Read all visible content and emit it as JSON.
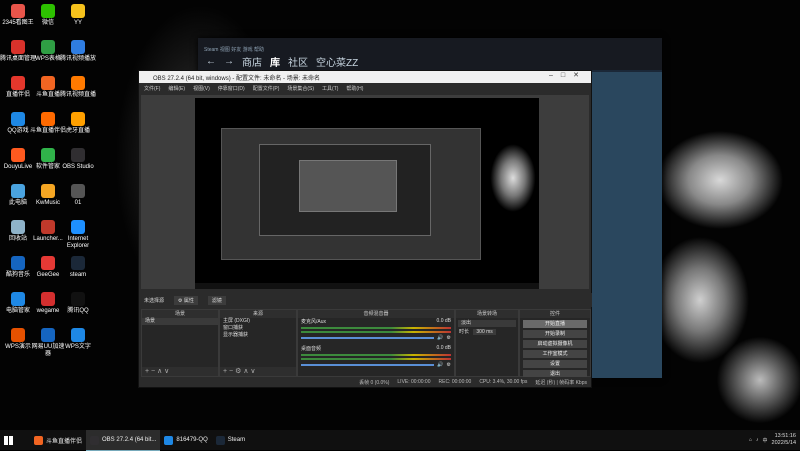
{
  "desktop": {
    "icons": [
      {
        "label": "2345看图王",
        "color": "#e8554a"
      },
      {
        "label": "微信",
        "color": "#2dc100"
      },
      {
        "label": "YY",
        "color": "#f6c21c"
      },
      {
        "label": "腾讯桌面管理",
        "color": "#d8322b"
      },
      {
        "label": "WPS表格",
        "color": "#2f9e44"
      },
      {
        "label": "腾讯视频播放",
        "color": "#2f7de1"
      },
      {
        "label": "直播伴侣",
        "color": "#e4372c"
      },
      {
        "label": "斗鱼直播",
        "color": "#f26522"
      },
      {
        "label": "腾讯视频直播",
        "color": "#ff7a00"
      },
      {
        "label": "QQ游戏",
        "color": "#1e88e5"
      },
      {
        "label": "斗鱼直播伴侣",
        "color": "#ff6a00"
      },
      {
        "label": "虎牙直播",
        "color": "#ffa000"
      },
      {
        "label": "DouyuLive",
        "color": "#ff5a1f"
      },
      {
        "label": "软件管家",
        "color": "#30b34a"
      },
      {
        "label": "OBS Studio",
        "color": "#302e31"
      },
      {
        "label": "此电脑",
        "color": "#4aa3df"
      },
      {
        "label": "KwMusic",
        "color": "#f5a623"
      },
      {
        "label": "01",
        "color": "#555555"
      },
      {
        "label": "回收站",
        "color": "#8fb3c9"
      },
      {
        "label": "Launcher...",
        "color": "#c0392b"
      },
      {
        "label": "Internet Explorer",
        "color": "#1e90ff"
      },
      {
        "label": "酷狗音乐",
        "color": "#1565c0"
      },
      {
        "label": "GeeGee",
        "color": "#e53935"
      },
      {
        "label": "steam",
        "color": "#1b2838"
      },
      {
        "label": "电脑管家",
        "color": "#1e88e5"
      },
      {
        "label": "wegame",
        "color": "#d32f2f"
      },
      {
        "label": "腾讯QQ",
        "color": "#111111"
      },
      {
        "label": "WPS演示",
        "color": "#e65100"
      },
      {
        "label": "网易UU加速器",
        "color": "#1565c0"
      },
      {
        "label": "WPS文字",
        "color": "#1e88e5"
      }
    ]
  },
  "steam": {
    "titlebar_text": "Steam 视图 好友 游戏 帮助",
    "nav": {
      "back": "←",
      "forward": "→",
      "store": "商店",
      "library": "库",
      "community": "社区",
      "user": "空心菜ZZ"
    }
  },
  "obs": {
    "title": "OBS 27.2.4 (64 bit, windows) - 配置文件: 未命名 - 场景: 未命名",
    "menu": [
      "文件(F)",
      "编辑(E)",
      "视图(V)",
      "停靠窗口(D)",
      "配置文件(P)",
      "场景集合(S)",
      "工具(T)",
      "帮助(H)"
    ],
    "no_source_selected": "未选择源",
    "properties_btn": "⚙ 属性",
    "filters_btn": "滤镜",
    "scenes": {
      "title": "场景",
      "items": [
        "场景"
      ]
    },
    "sources": {
      "title": "来源",
      "items": [
        "主屏 (DXGI)",
        "窗口捕获",
        "显示器捕获"
      ]
    },
    "mixer": {
      "title": "音频混音器",
      "channels": [
        {
          "name": "麦克风/Aux",
          "db": "0.0 dB"
        },
        {
          "name": "桌面音频",
          "db": "0.0 dB"
        }
      ]
    },
    "transitions": {
      "title": "场景转场",
      "type": "淡出",
      "duration_label": "时长",
      "duration": "300 ms"
    },
    "controls": {
      "title": "控件",
      "buttons": [
        "开始直播",
        "开始录制",
        "启动虚拟摄像机",
        "工作室模式",
        "设置",
        "退出"
      ]
    },
    "status": {
      "dropped": "丢帧 0 (0.0%)",
      "live": "LIVE: 00:00:00",
      "rec": "REC: 00:00:00",
      "cpu": "CPU: 3.4%, 30.00 fps",
      "right_note": "延迟 (秒) | 帧码率 Kbps"
    }
  },
  "taskbar": {
    "items": [
      {
        "label": "斗鱼直播伴侣",
        "color": "#f26522",
        "active": false
      },
      {
        "label": "OBS 27.2.4 (64 bit...",
        "color": "#302e31",
        "active": true
      },
      {
        "label": "816479-QQ",
        "color": "#1e88e5",
        "active": false
      },
      {
        "label": "Steam",
        "color": "#1b2838",
        "active": false
      }
    ],
    "time": "13:51:16",
    "date": "2022/5/14",
    "lang": "中"
  }
}
